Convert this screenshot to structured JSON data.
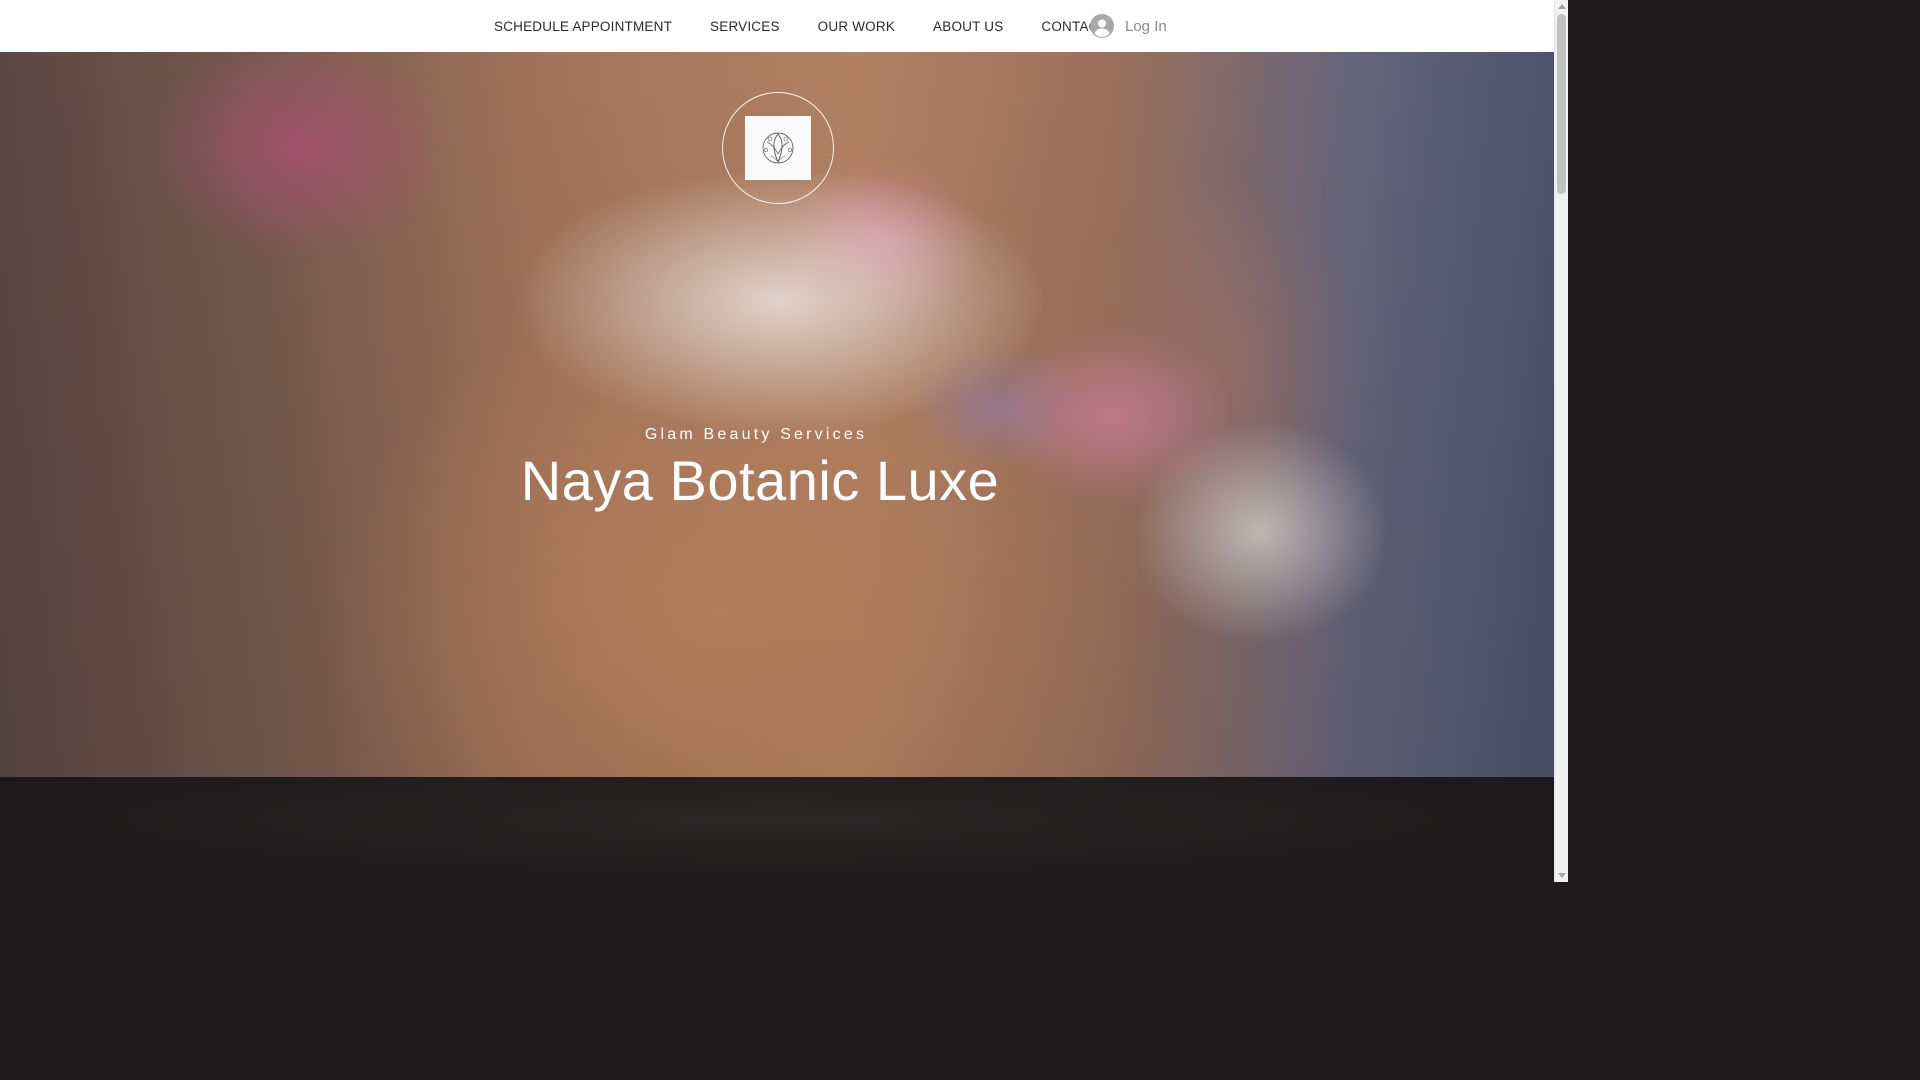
{
  "header": {
    "nav": [
      "SCHEDULE APPOINTMENT",
      "SERVICES",
      "OUR WORK",
      "ABOUT US",
      "CONTACT"
    ],
    "login_label": "Log In"
  },
  "hero": {
    "tagline": "Glam Beauty Services",
    "title": "Naya Botanic Luxe"
  },
  "colors": {
    "header_bg": "#ffffff",
    "nav_text": "#2b2b2b",
    "hero_text": "#ffffff",
    "dark_section": "#1d1b1b"
  },
  "icons": {
    "login": "user-avatar-icon",
    "logo": "botanical-logo-icon"
  }
}
